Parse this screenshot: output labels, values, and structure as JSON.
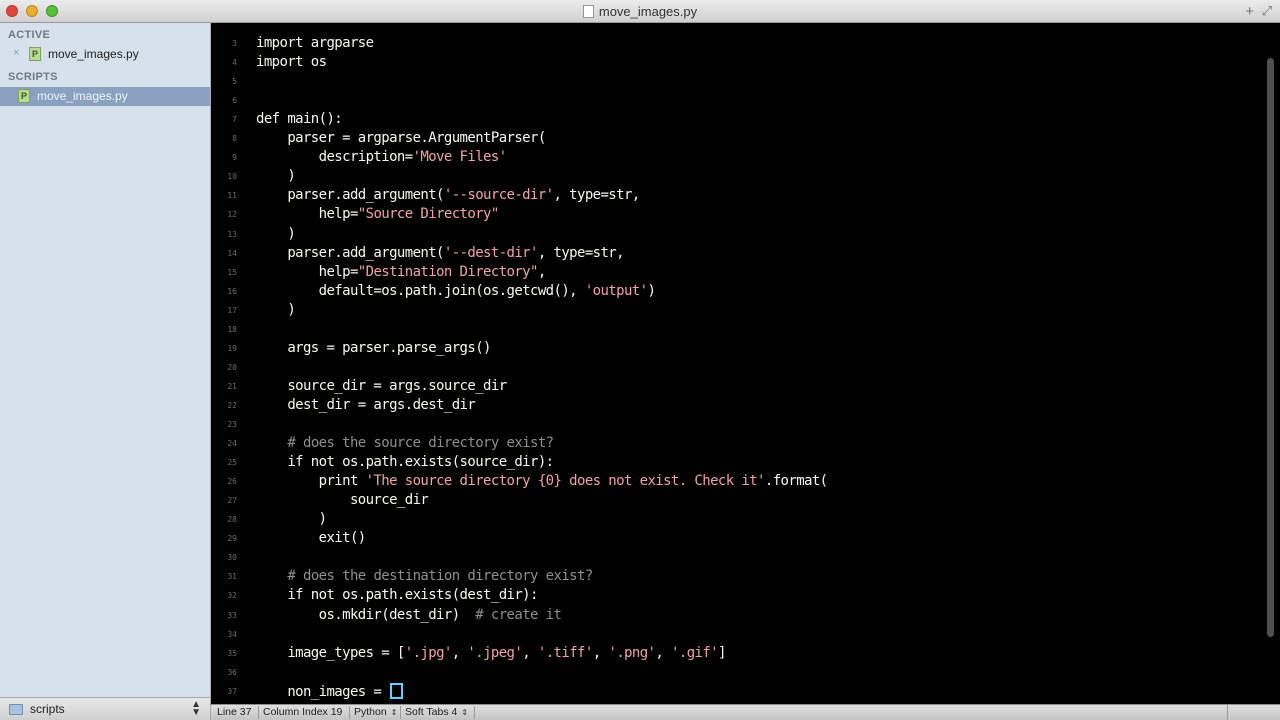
{
  "window": {
    "title": "move_images.py"
  },
  "sidebar": {
    "active_heading": "ACTIVE",
    "active_file": "move_images.py",
    "close_glyph": "×",
    "file_icon_letter": "P",
    "scripts_heading": "SCRIPTS",
    "tree_file": "move_images.py"
  },
  "folder": {
    "name": "scripts"
  },
  "editor": {
    "lines": [
      {
        "n": "3",
        "code": "import argparse"
      },
      {
        "n": "4",
        "code": "import os"
      },
      {
        "n": "5",
        "code": ""
      },
      {
        "n": "6",
        "code": ""
      },
      {
        "n": "7",
        "code": "def main():"
      },
      {
        "n": "8",
        "code": "    parser = argparse.ArgumentParser("
      },
      {
        "n": "9",
        "code": "        description=",
        "str": "'Move Files'",
        "after": ""
      },
      {
        "n": "10",
        "code": "    )"
      },
      {
        "n": "11",
        "code": "    parser.add_argument(",
        "str": "'--source-dir'",
        "after": ", type=str,"
      },
      {
        "n": "12",
        "code": "        help=",
        "str": "\"Source Directory\"",
        "after": ""
      },
      {
        "n": "13",
        "code": "    )"
      },
      {
        "n": "14",
        "code": "    parser.add_argument(",
        "str": "'--dest-dir'",
        "after": ", type=str,"
      },
      {
        "n": "15",
        "code": "        help=",
        "str": "\"Destination Directory\"",
        "after": ","
      },
      {
        "n": "16",
        "code": "        default=os.path.join(os.getcwd(), ",
        "str": "'output'",
        "after": ")"
      },
      {
        "n": "17",
        "code": "    )"
      },
      {
        "n": "18",
        "code": ""
      },
      {
        "n": "19",
        "code": "    args = parser.parse_args()"
      },
      {
        "n": "20",
        "code": ""
      },
      {
        "n": "21",
        "code": "    source_dir = args.source_dir"
      },
      {
        "n": "22",
        "code": "    dest_dir = args.dest_dir"
      },
      {
        "n": "23",
        "code": ""
      },
      {
        "n": "24",
        "code": "    ",
        "cmt": "# does the source directory exist?"
      },
      {
        "n": "25",
        "code": "    if not os.path.exists(source_dir):"
      },
      {
        "n": "26",
        "code": "        print ",
        "str": "'The source directory {0} does not exist. Check it'",
        "after": ".format("
      },
      {
        "n": "27",
        "code": "            source_dir"
      },
      {
        "n": "28",
        "code": "        )"
      },
      {
        "n": "29",
        "code": "        exit()"
      },
      {
        "n": "30",
        "code": ""
      },
      {
        "n": "31",
        "code": "    ",
        "cmt": "# does the destination directory exist?"
      },
      {
        "n": "32",
        "code": "    if not os.path.exists(dest_dir):"
      },
      {
        "n": "33",
        "code": "        os.mkdir(dest_dir)  ",
        "cmt": "# create it"
      },
      {
        "n": "34",
        "code": ""
      },
      {
        "n": "35",
        "code": "    image_types = [",
        "str": "'.jpg'",
        "after": ", ",
        "str2": "'.jpeg'",
        "after2": ", ",
        "str3": "'.tiff'",
        "after3": ", ",
        "str4": "'.png'",
        "after4": ", ",
        "str5": "'.gif'",
        "after5": "]"
      },
      {
        "n": "36",
        "code": ""
      },
      {
        "n": "37",
        "code": "    non_images = ",
        "cursor": true
      }
    ]
  },
  "statusbar": {
    "line": "Line 37",
    "column": "Column Index 19",
    "language": "Python",
    "tabs": "Soft Tabs 4"
  }
}
